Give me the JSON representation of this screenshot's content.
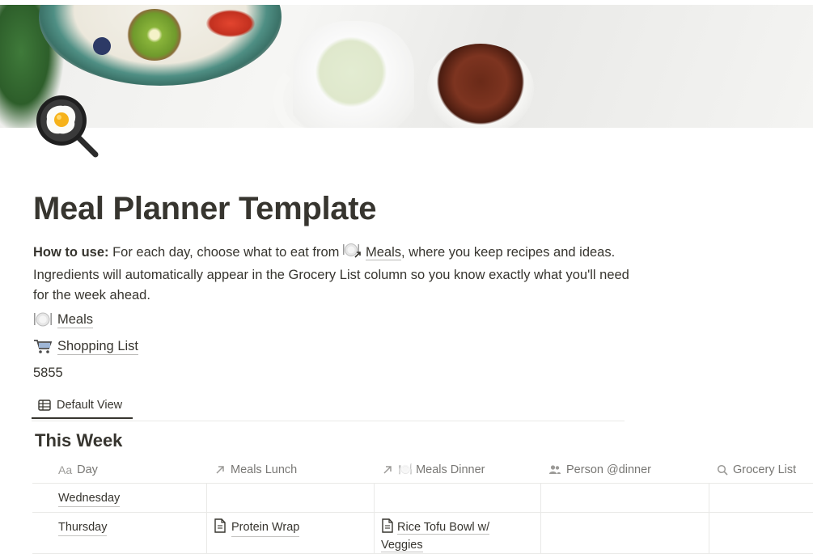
{
  "page": {
    "title": "Meal Planner Template",
    "icon": "frying-pan-egg-icon",
    "description": {
      "bold_lead": "How to use:",
      "text_1": " For each day, choose what to eat from ",
      "link_label": "Meals",
      "text_2": ", where you keep recipes and ideas. Ingredients will automatically appear in the Grocery List column so you know exactly what you'll need for the week ahead."
    },
    "links": [
      {
        "icon": "plate-icon",
        "label": "Meals"
      },
      {
        "icon": "shopping-cart-icon",
        "label": "Shopping List"
      }
    ],
    "number": "5855"
  },
  "views": {
    "active": "Default View",
    "icon": "table-icon"
  },
  "database": {
    "title": "This Week",
    "columns": [
      {
        "label": "Day",
        "icon": "Aa"
      },
      {
        "label": "Meals Lunch",
        "icon": "relation-arrow-icon"
      },
      {
        "label": "🍽️ Meals Dinner",
        "icon": "relation-arrow-icon"
      },
      {
        "label": "Person @dinner",
        "icon": "people-icon"
      },
      {
        "label": "Grocery List",
        "icon": "search-icon"
      }
    ],
    "rows": [
      {
        "day": "Wednesday",
        "lunch": "",
        "dinner": "",
        "person": "",
        "grocery": ""
      },
      {
        "day": "Thursday",
        "lunch": "Protein Wrap",
        "dinner": "Rice Tofu Bowl w/ Veggies",
        "person": "",
        "grocery": ""
      }
    ]
  }
}
